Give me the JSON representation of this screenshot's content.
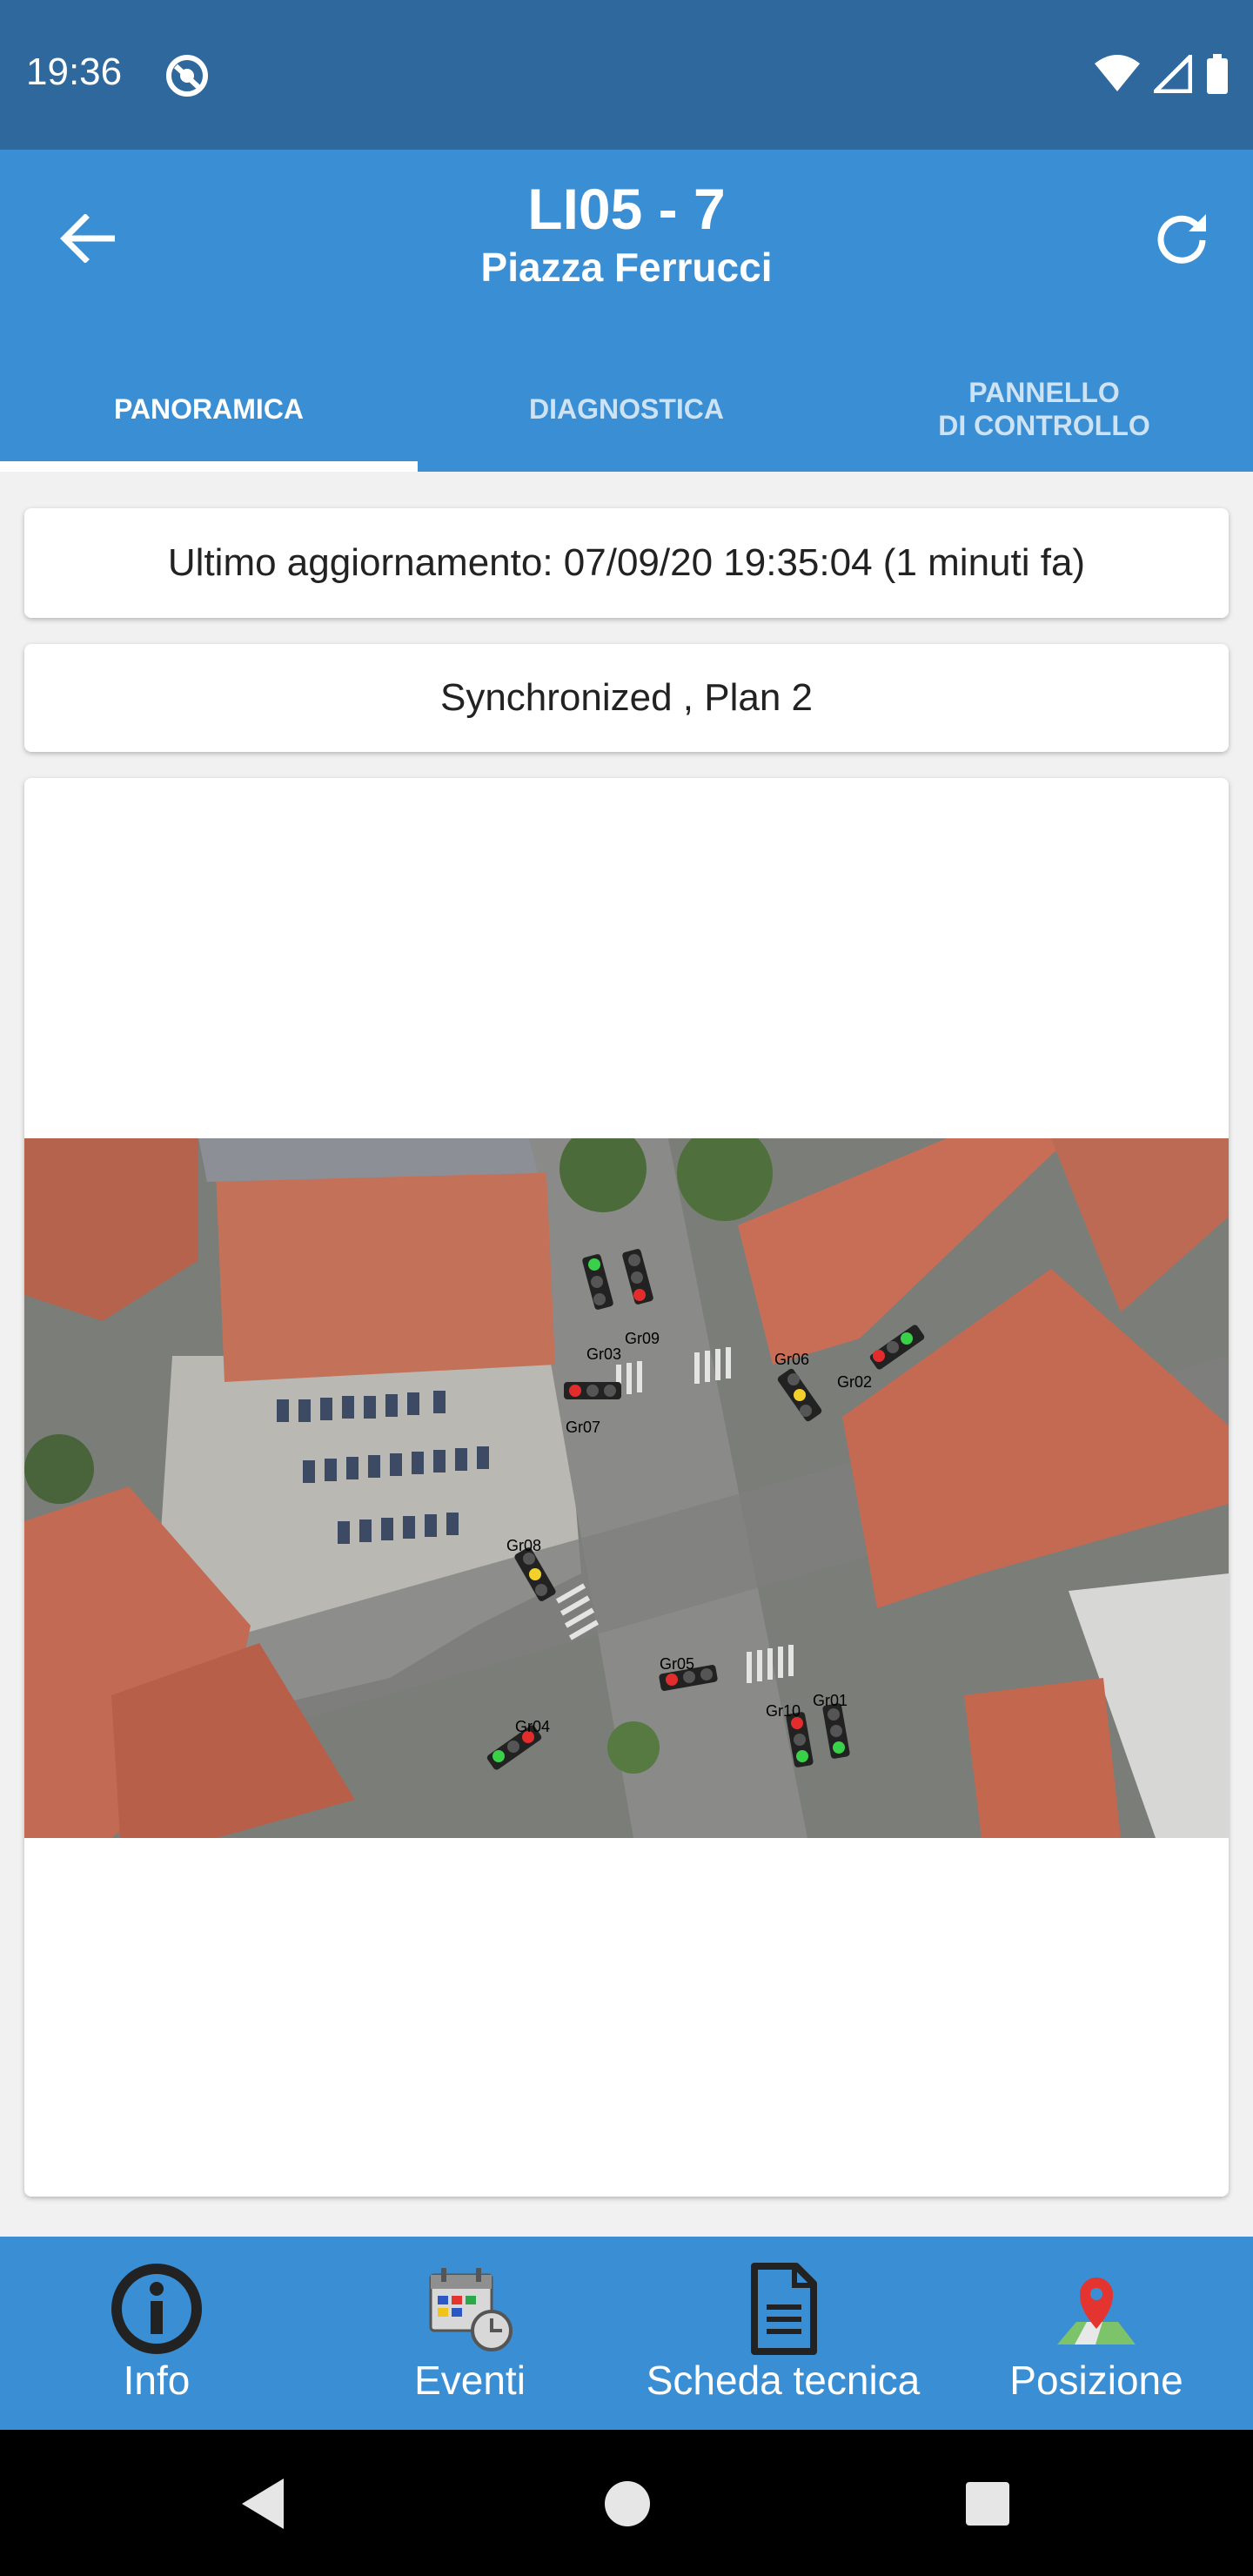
{
  "status_bar": {
    "time": "19:36"
  },
  "header": {
    "title": "LI05 - 7",
    "subtitle": "Piazza Ferrucci"
  },
  "tabs": [
    {
      "label": "PANORAMICA",
      "active": true
    },
    {
      "label": "DIAGNOSTICA",
      "active": false
    },
    {
      "label": "PANNELLO\nDI CONTROLLO",
      "active": false
    }
  ],
  "update_card": {
    "text": "Ultimo aggiornamento: 07/09/20 19:35:04 (1 minuti fa)"
  },
  "status_card": {
    "text": "Synchronized , Plan 2"
  },
  "map": {
    "signal_groups": [
      "Gr01",
      "Gr02",
      "Gr03",
      "Gr04",
      "Gr05",
      "Gr06",
      "Gr07",
      "Gr08",
      "Gr09",
      "Gr10"
    ]
  },
  "bottom_nav": [
    {
      "label": "Info",
      "icon": "info-icon"
    },
    {
      "label": "Eventi",
      "icon": "calendar-clock-icon"
    },
    {
      "label": "Scheda tecnica",
      "icon": "document-icon"
    },
    {
      "label": "Posizione",
      "icon": "map-pin-icon"
    }
  ],
  "colors": {
    "status_bar": "#2f689c",
    "app_bar": "#3a8ed4",
    "background": "#f1f1f1"
  }
}
